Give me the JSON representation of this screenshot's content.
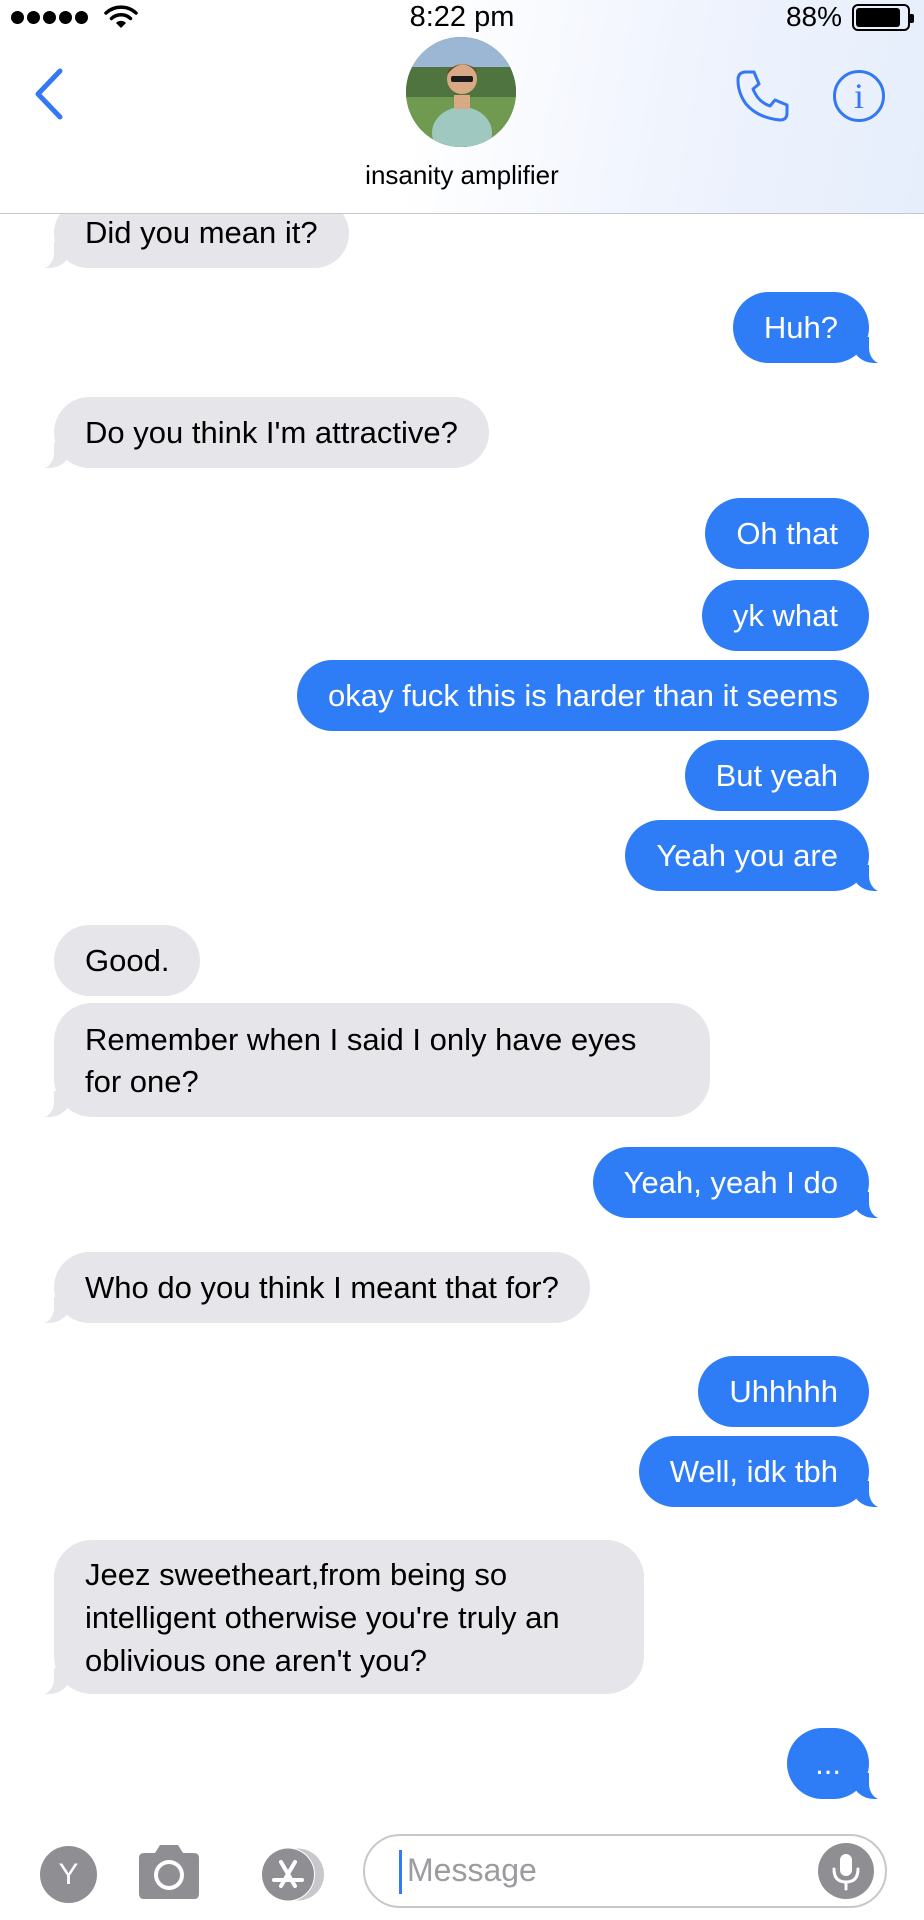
{
  "status_bar": {
    "time": "8:22 pm",
    "battery_percent": "88%",
    "signal_bars": 5,
    "battery_level": 0.88
  },
  "header": {
    "contact_name": "insanity amplifier",
    "back_icon": "chevron-left-icon",
    "call_icon": "phone-icon",
    "info_icon": "info-icon",
    "info_glyph": "i"
  },
  "messages": [
    {
      "side": "in",
      "text": "Did you mean it?"
    },
    {
      "side": "out",
      "text": "Huh?"
    },
    {
      "side": "in",
      "text": "Do you think I'm attractive?"
    },
    {
      "side": "out",
      "text": "Oh that"
    },
    {
      "side": "out",
      "text": "yk what"
    },
    {
      "side": "out",
      "text": "okay fuck this is harder than it seems"
    },
    {
      "side": "out",
      "text": "But yeah"
    },
    {
      "side": "out",
      "text": "Yeah you are"
    },
    {
      "side": "in",
      "text": "Good."
    },
    {
      "side": "in",
      "text": "Remember when I said I only have eyes for one?"
    },
    {
      "side": "out",
      "text": "Yeah, yeah I do"
    },
    {
      "side": "in",
      "text": "Who do you think I meant that for?"
    },
    {
      "side": "out",
      "text": "Uhhhhh"
    },
    {
      "side": "out",
      "text": "Well, idk tbh"
    },
    {
      "side": "in",
      "text": "Jeez sweetheart,from being so intelligent otherwise you're truly an oblivious one aren't you?"
    },
    {
      "side": "out",
      "text": "..."
    }
  ],
  "input_bar": {
    "app_button_letter": "Y",
    "message_placeholder": "Message",
    "camera_icon": "camera-icon",
    "appstore_icon": "app-store-icon",
    "mic_icon": "microphone-icon"
  },
  "colors": {
    "accent": "#3478f6",
    "outgoing_bubble": "#2e7cf6",
    "incoming_bubble": "#e5e5ea"
  }
}
